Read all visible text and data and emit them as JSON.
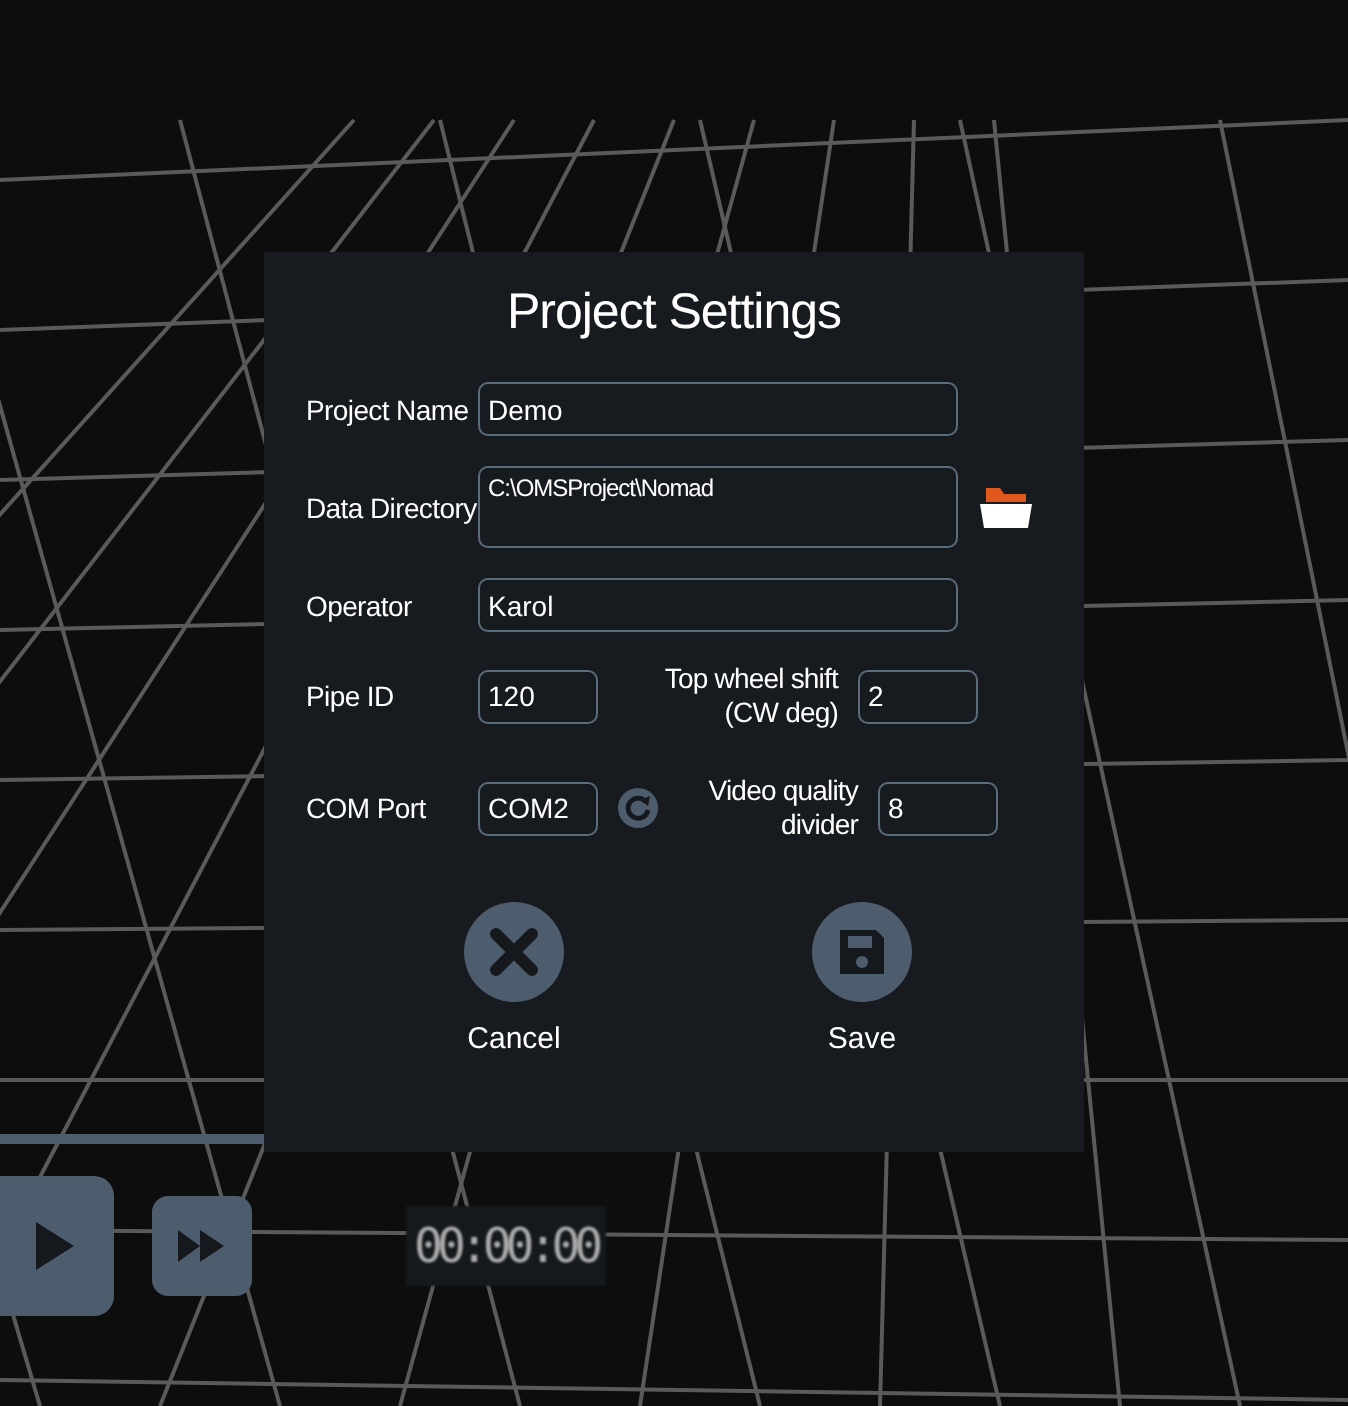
{
  "dialog": {
    "title": "Project Settings",
    "project_name": {
      "label": "Project Name",
      "value": "Demo"
    },
    "data_directory": {
      "label": "Data Directory",
      "value": "C:\\OMSProject\\Nomad"
    },
    "operator": {
      "label": "Operator",
      "value": "Karol"
    },
    "pipe_id": {
      "label": "Pipe ID",
      "value": "120"
    },
    "top_wheel_shift": {
      "label": "Top wheel shift (CW deg)",
      "value": "2"
    },
    "com_port": {
      "label": "COM Port",
      "value": "COM2"
    },
    "video_quality_divider": {
      "label": "Video quality divider",
      "value": "8"
    },
    "buttons": [
      {
        "kind": "cancel",
        "label": "Cancel"
      },
      {
        "kind": "save",
        "label": "Save"
      }
    ]
  },
  "player": {
    "timecode": "00:00:00"
  }
}
